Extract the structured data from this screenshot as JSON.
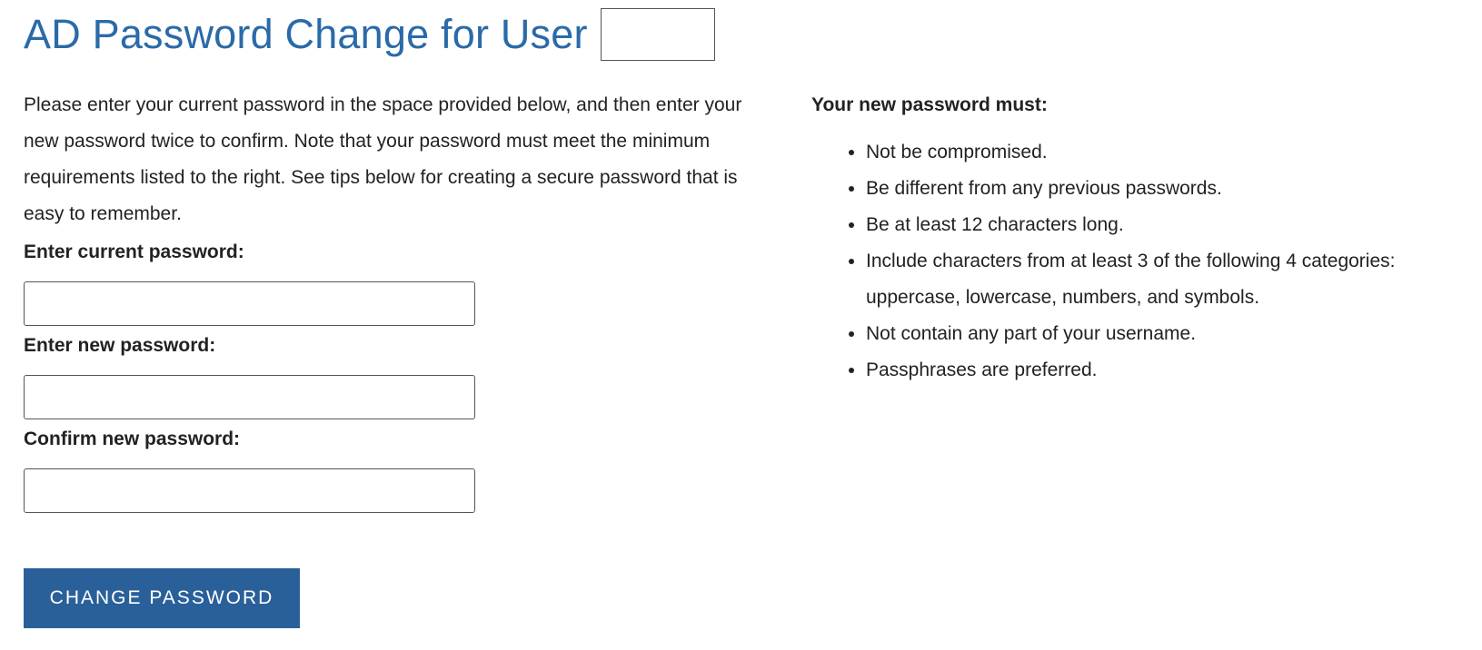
{
  "header": {
    "title": "AD Password Change for User",
    "username_value": ""
  },
  "intro": {
    "text": "Please enter your current password in the space provided below, and then enter your new password twice to confirm. Note that your password must meet the minimum requirements listed to the right. See tips below for creating a secure password that is easy to remember."
  },
  "form": {
    "current_label": "Enter current password:",
    "current_value": "",
    "new_label": "Enter new password:",
    "new_value": "",
    "confirm_label": "Confirm new password:",
    "confirm_value": "",
    "submit_label": "CHANGE PASSWORD"
  },
  "requirements": {
    "heading": "Your new password must:",
    "items": [
      "Not be compromised.",
      "Be different from any previous passwords.",
      "Be at least 12 characters long.",
      "Include characters from at least 3 of the following 4 categories: uppercase, lowercase, numbers, and symbols.",
      "Not contain any part of your username.",
      "Passphrases are preferred."
    ]
  },
  "colors": {
    "title": "#2a6aa8",
    "button_bg": "#2a6099",
    "button_text": "#ffffff",
    "text": "#222222"
  }
}
